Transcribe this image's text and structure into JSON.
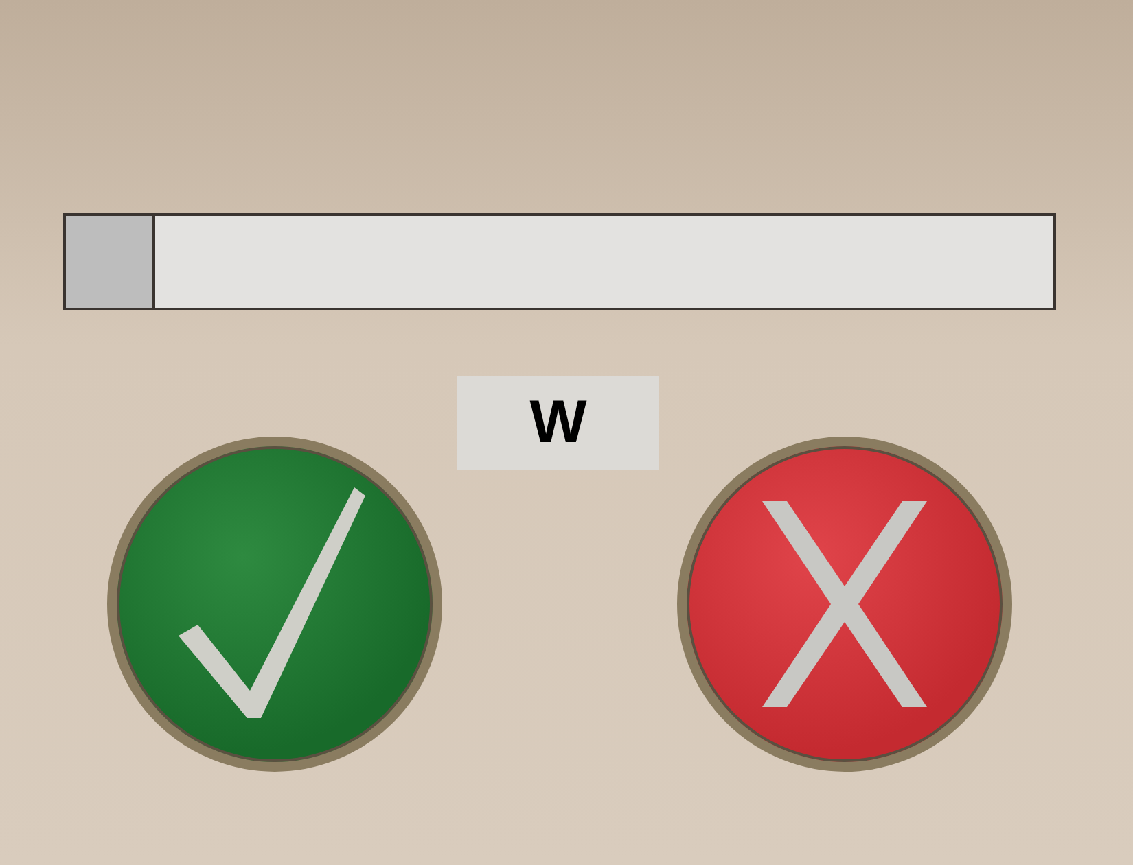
{
  "progress": {
    "level": 0.09
  },
  "label": "W",
  "buttons": [
    {
      "kind": "confirm"
    },
    {
      "kind": "cancel"
    }
  ]
}
